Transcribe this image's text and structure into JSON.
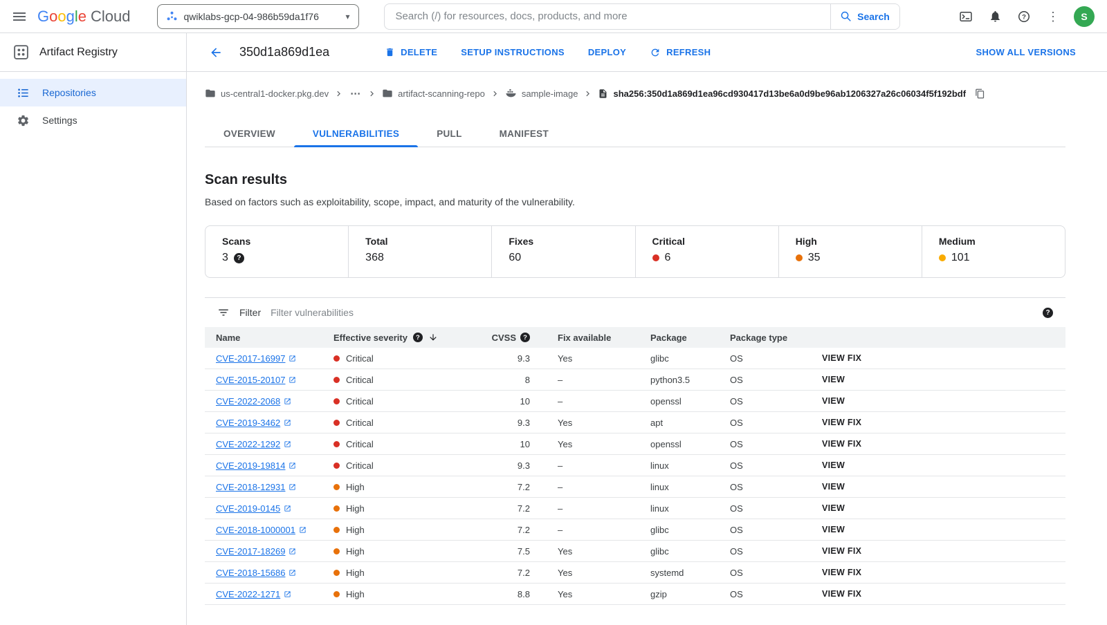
{
  "colors": {
    "critical": "#d93025",
    "high": "#e8710a",
    "medium": "#f9ab00",
    "link": "#1a73e8"
  },
  "glyphs": {
    "question": "?",
    "caret_down": "▾",
    "ellipsis": "⋯",
    "more_vert": "⋮"
  },
  "topbar": {
    "google_letters": [
      {
        "ch": "G",
        "color": "#4285f4"
      },
      {
        "ch": "o",
        "color": "#ea4335"
      },
      {
        "ch": "o",
        "color": "#fbbc04"
      },
      {
        "ch": "g",
        "color": "#4285f4"
      },
      {
        "ch": "l",
        "color": "#34a853"
      },
      {
        "ch": "e",
        "color": "#ea4335"
      }
    ],
    "cloud": "Cloud",
    "project_name": "qwiklabs-gcp-04-986b59da1f76",
    "search_placeholder": "Search (/) for resources, docs, products, and more",
    "search_button": "Search",
    "avatar_letter": "S"
  },
  "sidebar": {
    "product": "Artifact Registry",
    "items": [
      {
        "label": "Repositories",
        "selected": true
      },
      {
        "label": "Settings",
        "selected": false
      }
    ]
  },
  "toolbar": {
    "title": "350d1a869d1ea",
    "delete": "DELETE",
    "setup": "SETUP INSTRUCTIONS",
    "deploy": "DEPLOY",
    "refresh": "REFRESH",
    "show_all": "SHOW ALL VERSIONS"
  },
  "breadcrumb": {
    "host": "us-central1-docker.pkg.dev",
    "ellipsis": "⋯",
    "repo": "artifact-scanning-repo",
    "image": "sample-image",
    "digest": "sha256:350d1a869d1ea96cd930417d13be6a0d9be96ab1206327a26c06034f5f192bdf"
  },
  "tabs": [
    {
      "label": "OVERVIEW",
      "selected": false
    },
    {
      "label": "VULNERABILITIES",
      "selected": true
    },
    {
      "label": "PULL",
      "selected": false
    },
    {
      "label": "MANIFEST",
      "selected": false
    }
  ],
  "scan": {
    "title": "Scan results",
    "subtitle": "Based on factors such as exploitability, scope, impact, and maturity of the vulnerability.",
    "stats": [
      {
        "label": "Scans",
        "value": "3",
        "help": true
      },
      {
        "label": "Total",
        "value": "368"
      },
      {
        "label": "Fixes",
        "value": "60"
      },
      {
        "label": "Critical",
        "value": "6",
        "dot": "critical"
      },
      {
        "label": "High",
        "value": "35",
        "dot": "high"
      },
      {
        "label": "Medium",
        "value": "101",
        "dot": "medium"
      }
    ]
  },
  "filter": {
    "label": "Filter",
    "placeholder": "Filter vulnerabilities"
  },
  "table": {
    "headers": {
      "name": "Name",
      "severity": "Effective severity",
      "cvss": "CVSS",
      "fix": "Fix available",
      "package": "Package",
      "package_type": "Package type"
    },
    "rows": [
      {
        "name": "CVE-2017-16997",
        "severity": "Critical",
        "cvss": "9.3",
        "fix": "Yes",
        "package": "glibc",
        "type": "OS",
        "action": "VIEW FIX"
      },
      {
        "name": "CVE-2015-20107",
        "severity": "Critical",
        "cvss": "8",
        "fix": "–",
        "package": "python3.5",
        "type": "OS",
        "action": "VIEW"
      },
      {
        "name": "CVE-2022-2068",
        "severity": "Critical",
        "cvss": "10",
        "fix": "–",
        "package": "openssl",
        "type": "OS",
        "action": "VIEW"
      },
      {
        "name": "CVE-2019-3462",
        "severity": "Critical",
        "cvss": "9.3",
        "fix": "Yes",
        "package": "apt",
        "type": "OS",
        "action": "VIEW FIX"
      },
      {
        "name": "CVE-2022-1292",
        "severity": "Critical",
        "cvss": "10",
        "fix": "Yes",
        "package": "openssl",
        "type": "OS",
        "action": "VIEW FIX"
      },
      {
        "name": "CVE-2019-19814",
        "severity": "Critical",
        "cvss": "9.3",
        "fix": "–",
        "package": "linux",
        "type": "OS",
        "action": "VIEW"
      },
      {
        "name": "CVE-2018-12931",
        "severity": "High",
        "cvss": "7.2",
        "fix": "–",
        "package": "linux",
        "type": "OS",
        "action": "VIEW"
      },
      {
        "name": "CVE-2019-0145",
        "severity": "High",
        "cvss": "7.2",
        "fix": "–",
        "package": "linux",
        "type": "OS",
        "action": "VIEW"
      },
      {
        "name": "CVE-2018-1000001",
        "severity": "High",
        "cvss": "7.2",
        "fix": "–",
        "package": "glibc",
        "type": "OS",
        "action": "VIEW"
      },
      {
        "name": "CVE-2017-18269",
        "severity": "High",
        "cvss": "7.5",
        "fix": "Yes",
        "package": "glibc",
        "type": "OS",
        "action": "VIEW FIX"
      },
      {
        "name": "CVE-2018-15686",
        "severity": "High",
        "cvss": "7.2",
        "fix": "Yes",
        "package": "systemd",
        "type": "OS",
        "action": "VIEW FIX"
      },
      {
        "name": "CVE-2022-1271",
        "severity": "High",
        "cvss": "8.8",
        "fix": "Yes",
        "package": "gzip",
        "type": "OS",
        "action": "VIEW FIX"
      }
    ]
  }
}
